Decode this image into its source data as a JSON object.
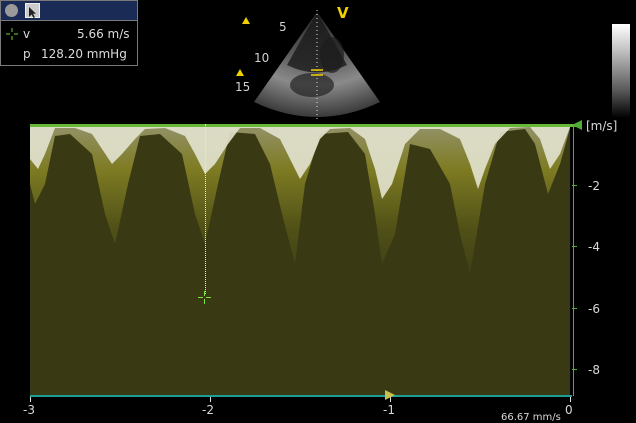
{
  "measurement": {
    "velocity_label": "v",
    "velocity_value": "5.66 m/s",
    "pressure_label": "p",
    "pressure_value": "128.20 mmHg"
  },
  "sector": {
    "depth_labels": [
      "5",
      "10",
      "15"
    ],
    "view_marker": "V"
  },
  "spectrum": {
    "unit_label": "[m/s]",
    "y_ticks": [
      "-2",
      "-4",
      "-6",
      "-8"
    ],
    "x_ticks": [
      "-3",
      "-2",
      "-1",
      "0"
    ],
    "sweep_speed": "66.67 mm/s"
  },
  "colors": {
    "doppler": "#d8d238",
    "axis": "#4fae3a",
    "baseline": "#1f9e95",
    "marker": "#f0d000"
  }
}
